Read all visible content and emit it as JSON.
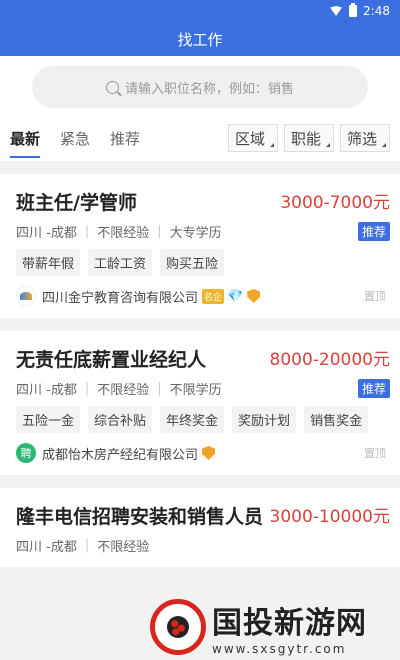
{
  "status": {
    "time": "2:48"
  },
  "header": {
    "title": "找工作"
  },
  "search": {
    "placeholder": "请输入职位名称，例如：销售"
  },
  "tabs": [
    {
      "label": "最新",
      "active": true
    },
    {
      "label": "紧急"
    },
    {
      "label": "推荐"
    }
  ],
  "filters": [
    "区域",
    "职能",
    "筛选"
  ],
  "jobs": [
    {
      "title": "班主任/学管师",
      "salary": "3000-7000元",
      "location": "四川 -成都",
      "experience": "不限经验",
      "education": "大专学历",
      "badge": "推荐",
      "tags": [
        "带薪年假",
        "工龄工资",
        "购买五险"
      ],
      "company": "四川金宁教育咨询有限公司",
      "company_badge": "名企",
      "pin": "置顶"
    },
    {
      "title": "无责任底薪置业经纪人",
      "salary": "8000-20000元",
      "location": "四川 -成都",
      "experience": "不限经验",
      "education": "不限学历",
      "badge": "推荐",
      "tags": [
        "五险一金",
        "综合补贴",
        "年终奖金",
        "奖励计划",
        "销售奖金"
      ],
      "company": "成都怡木房产经纪有限公司",
      "company_logo_text": "聘",
      "pin": "置顶"
    },
    {
      "title": "隆丰电信招聘安装和销售人员",
      "salary": "3000-10000元",
      "location": "四川 -成都",
      "experience": "不限经验"
    }
  ],
  "watermark": {
    "text": "国投新游网",
    "url": "www.sxsgytr.com"
  }
}
